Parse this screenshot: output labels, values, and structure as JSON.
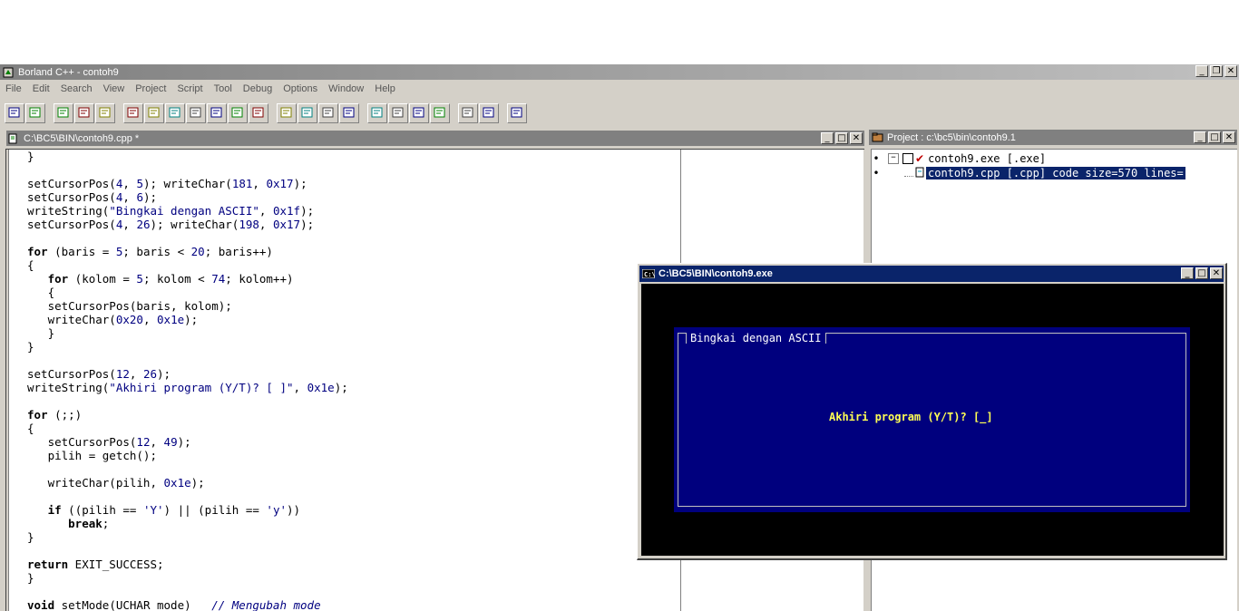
{
  "app": {
    "title": "Borland C++ - contoh9",
    "menu": [
      "File",
      "Edit",
      "Search",
      "View",
      "Project",
      "Script",
      "Tool",
      "Debug",
      "Options",
      "Window",
      "Help"
    ]
  },
  "toolbar": {
    "groups": [
      [
        "open-project",
        "close-project"
      ],
      [
        "add-node",
        "delete-node",
        "edit-node"
      ],
      [
        "make",
        "build",
        "step-over",
        "trace-into",
        "run",
        "pause",
        "browse"
      ],
      [
        "undo",
        "cut",
        "copy",
        "paste"
      ],
      [
        "find",
        "replace",
        "search-again",
        "browse-symbol"
      ],
      [
        "window-tile",
        "window-cascade"
      ],
      [
        "help-context"
      ]
    ]
  },
  "editor": {
    "title": "C:\\BC5\\BIN\\contoh9.cpp *"
  },
  "project": {
    "title": "Project : c:\\bc5\\bin\\contoh9.1",
    "rows": [
      "contoh9.exe [.exe]",
      "contoh9.cpp [.cpp]  code size=570  lines="
    ]
  },
  "console": {
    "title": "C:\\BC5\\BIN\\contoh9.exe",
    "frame_title": "Bingkai dengan ASCII",
    "prompt": "Akhiri program (Y/T)? [_]"
  },
  "colors": {
    "active_title": "#0a246a",
    "inactive_title": "#808080",
    "console_bg": "#000000",
    "frame_bg": "#00007e",
    "prompt_fg": "#ffff54"
  }
}
